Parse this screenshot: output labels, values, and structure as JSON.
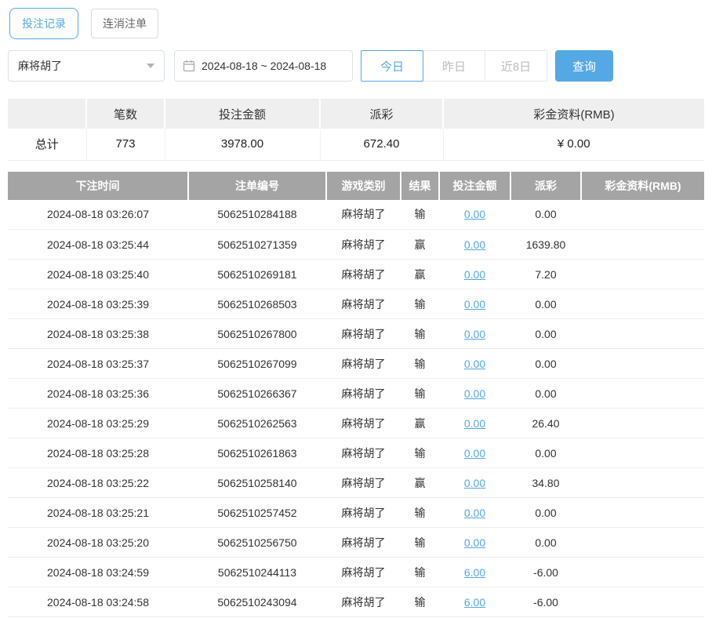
{
  "colors": {
    "accent": "#54a8e4",
    "negative": "#e25d5d",
    "table_header_bg": "#a4a4a4"
  },
  "tabs": [
    {
      "label": "投注记录",
      "active": true
    },
    {
      "label": "连消注单",
      "active": false
    }
  ],
  "filters": {
    "game_select": {
      "value": "麻将胡了"
    },
    "date_range": "2024-08-18 ~ 2024-08-18",
    "quick_buttons": [
      {
        "label": "今日",
        "active": true
      },
      {
        "label": "昨日",
        "active": false
      },
      {
        "label": "近8日",
        "active": false
      }
    ],
    "search_label": "查询"
  },
  "summary": {
    "headers": [
      "",
      "笔数",
      "投注金额",
      "派彩",
      "彩金资料(RMB)"
    ],
    "row": {
      "label": "总计",
      "count": "773",
      "bet_amount": "3978.00",
      "payout": "672.40",
      "bonus": "¥ 0.00"
    }
  },
  "table": {
    "headers": [
      "下注时间",
      "注单编号",
      "游戏类别",
      "结果",
      "投注金额",
      "派彩",
      "彩金资料(RMB)"
    ],
    "rows": [
      {
        "time": "2024-08-18 03:26:07",
        "order_id": "5062510284188",
        "game": "麻将胡了",
        "result": "输",
        "bet": "0.00",
        "payout": "0.00",
        "bonus": ""
      },
      {
        "time": "2024-08-18 03:25:44",
        "order_id": "5062510271359",
        "game": "麻将胡了",
        "result": "赢",
        "bet": "0.00",
        "payout": "1639.80",
        "bonus": ""
      },
      {
        "time": "2024-08-18 03:25:40",
        "order_id": "5062510269181",
        "game": "麻将胡了",
        "result": "赢",
        "bet": "0.00",
        "payout": "7.20",
        "bonus": ""
      },
      {
        "time": "2024-08-18 03:25:39",
        "order_id": "5062510268503",
        "game": "麻将胡了",
        "result": "输",
        "bet": "0.00",
        "payout": "0.00",
        "bonus": ""
      },
      {
        "time": "2024-08-18 03:25:38",
        "order_id": "5062510267800",
        "game": "麻将胡了",
        "result": "输",
        "bet": "0.00",
        "payout": "0.00",
        "bonus": ""
      },
      {
        "time": "2024-08-18 03:25:37",
        "order_id": "5062510267099",
        "game": "麻将胡了",
        "result": "输",
        "bet": "0.00",
        "payout": "0.00",
        "bonus": ""
      },
      {
        "time": "2024-08-18 03:25:36",
        "order_id": "5062510266367",
        "game": "麻将胡了",
        "result": "输",
        "bet": "0.00",
        "payout": "0.00",
        "bonus": ""
      },
      {
        "time": "2024-08-18 03:25:29",
        "order_id": "5062510262563",
        "game": "麻将胡了",
        "result": "赢",
        "bet": "0.00",
        "payout": "26.40",
        "bonus": ""
      },
      {
        "time": "2024-08-18 03:25:28",
        "order_id": "5062510261863",
        "game": "麻将胡了",
        "result": "输",
        "bet": "0.00",
        "payout": "0.00",
        "bonus": ""
      },
      {
        "time": "2024-08-18 03:25:22",
        "order_id": "5062510258140",
        "game": "麻将胡了",
        "result": "赢",
        "bet": "0.00",
        "payout": "34.80",
        "bonus": ""
      },
      {
        "time": "2024-08-18 03:25:21",
        "order_id": "5062510257452",
        "game": "麻将胡了",
        "result": "输",
        "bet": "0.00",
        "payout": "0.00",
        "bonus": ""
      },
      {
        "time": "2024-08-18 03:25:20",
        "order_id": "5062510256750",
        "game": "麻将胡了",
        "result": "输",
        "bet": "0.00",
        "payout": "0.00",
        "bonus": ""
      },
      {
        "time": "2024-08-18 03:24:59",
        "order_id": "5062510244113",
        "game": "麻将胡了",
        "result": "输",
        "bet": "6.00",
        "payout": "-6.00",
        "bonus": ""
      },
      {
        "time": "2024-08-18 03:24:58",
        "order_id": "5062510243094",
        "game": "麻将胡了",
        "result": "输",
        "bet": "6.00",
        "payout": "-6.00",
        "bonus": ""
      }
    ]
  }
}
